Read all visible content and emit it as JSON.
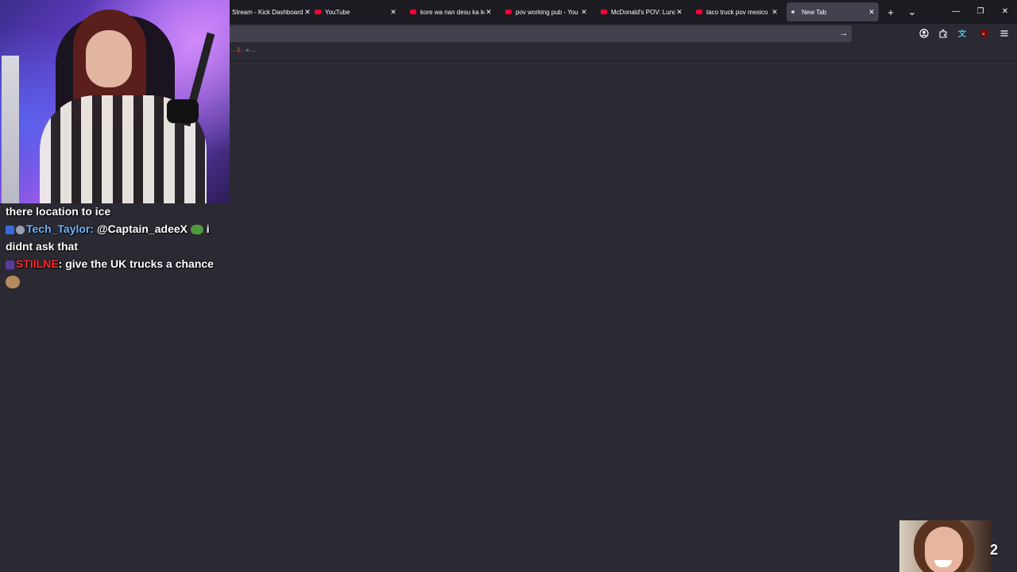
{
  "browser": {
    "tabs": [
      {
        "title": "Stream - Kick Dashboard",
        "favicon": "kick-icon",
        "active": false
      },
      {
        "title": "YouTube",
        "favicon": "youtube-icon",
        "active": false
      },
      {
        "title": "kore wa nan desu ka ko",
        "favicon": "youtube-icon",
        "active": false
      },
      {
        "title": "pov working pub - You",
        "favicon": "youtube-icon",
        "active": false
      },
      {
        "title": "McDonald's POV: Lunc",
        "favicon": "youtube-icon",
        "active": false
      },
      {
        "title": "taco truck pov mexico",
        "favicon": "youtube-icon",
        "active": false
      },
      {
        "title": "New Tab",
        "favicon": "dot-icon",
        "active": true
      }
    ],
    "close_glyph": "✕",
    "new_tab_glyph": "+",
    "tab_list_glyph": "⌄",
    "window": {
      "minimize": "—",
      "restore": "❐",
      "close": "✕"
    },
    "go_glyph": "→",
    "toolbar_icons": [
      "account-icon",
      "extensions-icon",
      "translate-icon",
      "ublock-icon",
      "menu-icon"
    ],
    "bookmarks_text": "·.·🍒.·ɞ·…"
  },
  "chat": {
    "lines": [
      {
        "text": "there location to ice"
      },
      {
        "badges": [
          "blue",
          "grey"
        ],
        "user": "Tech_Taylor",
        "mention": "@Captain_adeeX",
        "emote": "pepe",
        "message": "i didnt ask that"
      },
      {
        "badges": [
          "purple"
        ],
        "user": "STIILNE",
        "message": "give the UK trucks a chance",
        "emote": "cat"
      }
    ]
  },
  "overlay": {
    "viewer_count": "2"
  },
  "colors": {
    "tabstrip": "#1c1b22",
    "page_bg": "#2b2a33",
    "urlbar": "#42414d",
    "tech_taylor": "#6fb5ff",
    "stiilne": "#ff2a2a"
  }
}
